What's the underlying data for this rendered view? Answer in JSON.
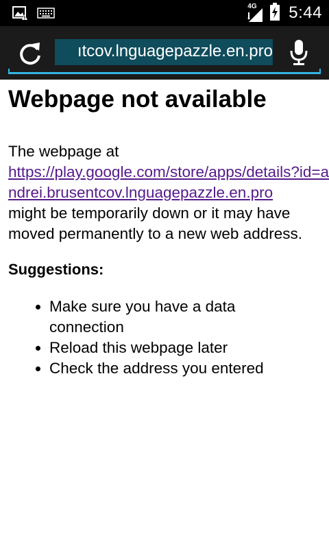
{
  "status_bar": {
    "notifications": [
      "image-warning-icon",
      "keyboard-icon"
    ],
    "network_label": "4G",
    "time": "5:44"
  },
  "browser": {
    "url_display": "ıtcov.lnguagepazzle.en.pro",
    "accent_color": "#33b5e5",
    "url_highlight_color": "#0f4c5c"
  },
  "page": {
    "title": "Webpage not available",
    "message_prefix": "The webpage at",
    "link_url": "https://play.google.com/store/apps/details?id=andrei.brusentcov.lnguagepazzle.en.pro",
    "message_suffix": "might be temporarily down or it may have moved permanently to a new web address.",
    "suggestions_heading": "Suggestions:",
    "suggestions": [
      "Make sure you have a data connection",
      "Reload this webpage later",
      "Check the address you entered"
    ],
    "link_color": "#551a8b"
  }
}
